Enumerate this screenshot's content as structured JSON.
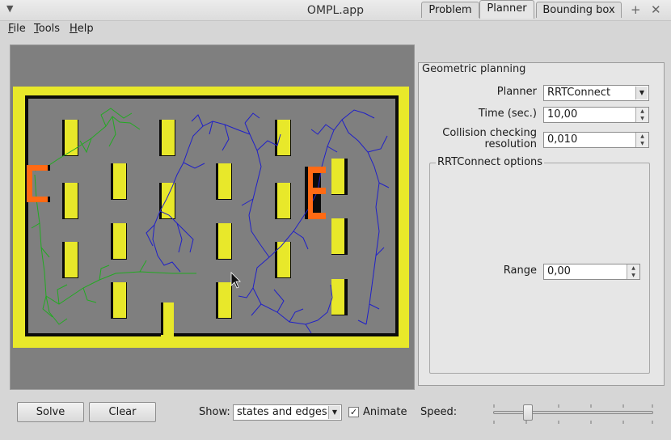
{
  "window": {
    "title": "OMPL.app",
    "controls": [
      "–",
      "+",
      "✕"
    ]
  },
  "menubar": {
    "items": [
      {
        "label": "File",
        "accel": "F",
        "rest": "ile"
      },
      {
        "label": "Tools",
        "accel": "T",
        "rest": "ools"
      },
      {
        "label": "Help",
        "accel": "H",
        "rest": "elp"
      }
    ]
  },
  "tabs": {
    "items": [
      "Problem",
      "Planner",
      "Bounding box"
    ],
    "active": "Planner"
  },
  "planner_panel": {
    "group_title": "Geometric planning",
    "planner_label": "Planner",
    "planner_value": "RRTConnect",
    "time_label": "Time (sec.)",
    "time_value": "10,00",
    "collision_label_line1": "Collision checking",
    "collision_label_line2": "resolution",
    "collision_value": "0,010",
    "options_title": "RRTConnect options",
    "range_label": "Range",
    "range_value": "0,00"
  },
  "bottom_bar": {
    "solve_label": "Solve",
    "clear_label": "Clear",
    "show_label": "Show:",
    "show_value": "states and edges",
    "animate_label": "Animate",
    "animate_checked": true,
    "speed_label": "Speed:",
    "speed_fraction": 0.2
  },
  "scene": {
    "colors": {
      "background": "#7f7f7f",
      "wall": "#e8e82a",
      "wall_shadow": "#0b0b0b",
      "robot": "#ff6a14",
      "start_tree": "#22aa22",
      "goal_tree": "#2020c8"
    }
  }
}
